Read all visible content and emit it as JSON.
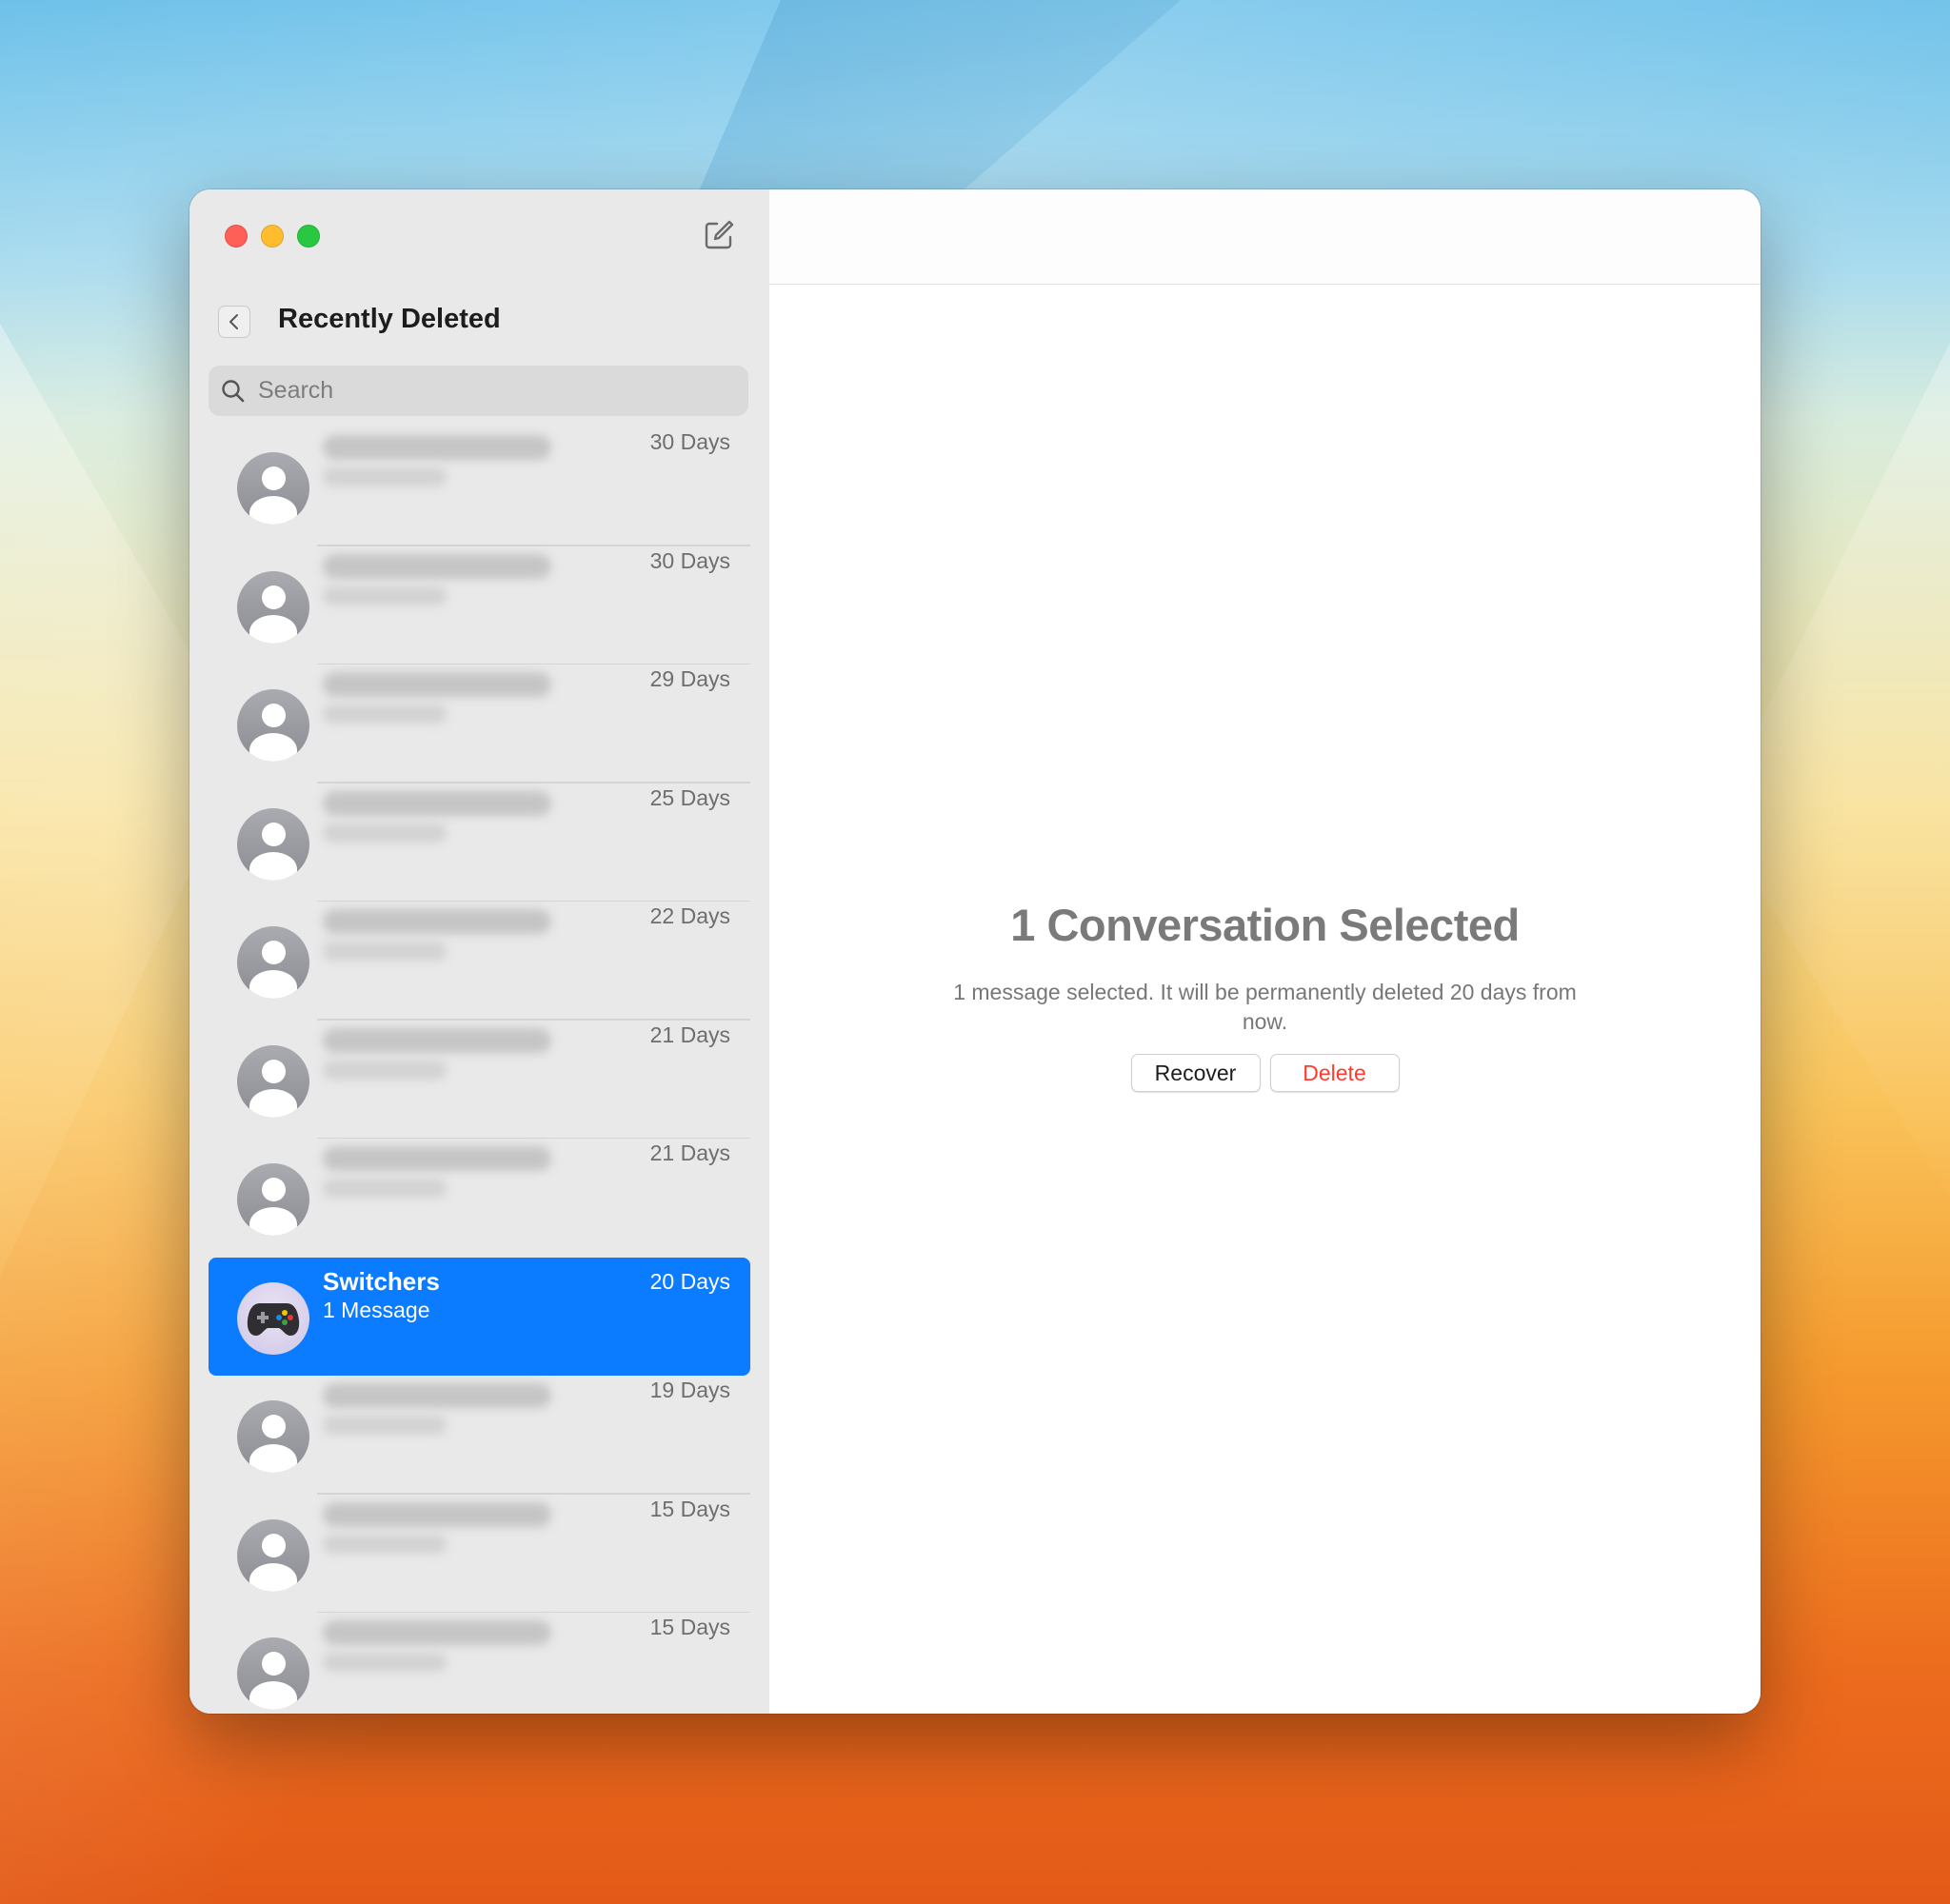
{
  "sidebar": {
    "title": "Recently Deleted",
    "search_placeholder": "Search",
    "conversations": [
      {
        "days": "30 Days"
      },
      {
        "days": "30 Days"
      },
      {
        "days": "29 Days"
      },
      {
        "days": "25 Days"
      },
      {
        "days": "22 Days"
      },
      {
        "days": "21 Days"
      },
      {
        "days": "21 Days"
      },
      {
        "name": "Switchers",
        "subtitle": "1 Message",
        "days": "20 Days",
        "selected": true
      },
      {
        "days": "19 Days"
      },
      {
        "days": "15 Days"
      },
      {
        "days": "15 Days"
      }
    ]
  },
  "main": {
    "title": "1 Conversation Selected",
    "description": "1 message selected. It will be permanently deleted 20 days from now.",
    "recover_label": "Recover",
    "delete_label": "Delete"
  },
  "colors": {
    "accent": "#0b7bff",
    "delete": "#ff3b30",
    "traffic_red": "#fe5f57",
    "traffic_yellow": "#febc2e",
    "traffic_green": "#28c840"
  },
  "icons": [
    "compose-icon",
    "back-chevron-icon",
    "search-icon",
    "contact-avatar-icon",
    "gamepad-icon"
  ]
}
